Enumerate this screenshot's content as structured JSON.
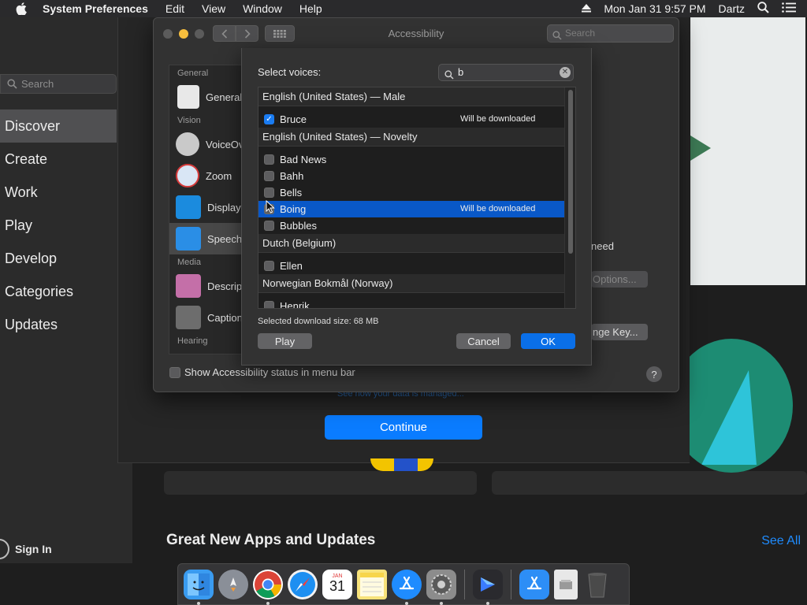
{
  "menubar": {
    "app_name": "System Preferences",
    "menus": [
      "Edit",
      "View",
      "Window",
      "Help"
    ],
    "datetime": "Mon Jan 31  9:57 PM",
    "user": "Dartz"
  },
  "store": {
    "search_placeholder": "Search",
    "nav": [
      {
        "label": "Discover",
        "active": true
      },
      {
        "label": "Create"
      },
      {
        "label": "Work"
      },
      {
        "label": "Play"
      },
      {
        "label": "Develop"
      },
      {
        "label": "Categories"
      },
      {
        "label": "Updates"
      }
    ],
    "sign_in": "Sign In",
    "section_title": "Great New Apps and Updates",
    "see_all": "See All",
    "link_text": "See how your data is managed...",
    "continue": "Continue"
  },
  "accessibility": {
    "title": "Accessibility",
    "search_placeholder": "Search",
    "sections": [
      {
        "header": "General",
        "items": [
          {
            "label": "General",
            "icon": "switch-icon"
          }
        ]
      },
      {
        "header": "Vision",
        "items": [
          {
            "label": "VoiceOver",
            "icon": "voiceover-icon"
          },
          {
            "label": "Zoom",
            "icon": "zoom-icon"
          },
          {
            "label": "Display",
            "icon": "display-icon"
          },
          {
            "label": "Speech",
            "icon": "speech-icon",
            "selected": true
          }
        ]
      },
      {
        "header": "Media",
        "items": [
          {
            "label": "Descriptions",
            "icon": "descriptions-icon"
          },
          {
            "label": "Captions",
            "icon": "captions-icon"
          }
        ]
      },
      {
        "header": "Hearing",
        "items": []
      }
    ],
    "status_checkbox": "Show Accessibility status in menu bar",
    "help": "?",
    "right_text_need": "need",
    "options_button": "Options...",
    "change_key_button": "nge Key..."
  },
  "voices": {
    "label": "Select voices:",
    "search_value": "b",
    "groups": [
      {
        "name": "English (United States) — Male",
        "items": [
          {
            "name": "Bruce",
            "checked": true,
            "note": "Will be downloaded"
          }
        ]
      },
      {
        "name": "English (United States) — Novelty",
        "items": [
          {
            "name": "Bad News",
            "checked": false
          },
          {
            "name": "Bahh",
            "checked": false
          },
          {
            "name": "Bells",
            "checked": false
          },
          {
            "name": "Boing",
            "checked": false,
            "selected": true,
            "note": "Will be downloaded"
          },
          {
            "name": "Bubbles",
            "checked": false
          }
        ]
      },
      {
        "name": "Dutch (Belgium)",
        "items": [
          {
            "name": "Ellen",
            "checked": false
          }
        ]
      },
      {
        "name": "Norwegian Bokmål (Norway)",
        "items": [
          {
            "name": "Henrik",
            "checked": false
          }
        ]
      }
    ],
    "download_size": "Selected download size: 68 MB",
    "play": "Play",
    "cancel": "Cancel",
    "ok": "OK"
  },
  "dock": {
    "apps": [
      {
        "name": "Finder",
        "icon": "finder-icon",
        "color": "#3a9bf0",
        "running": true
      },
      {
        "name": "Launchpad",
        "icon": "launchpad-icon",
        "color": "#8a8f98",
        "running": false
      },
      {
        "name": "Chrome",
        "icon": "chrome-icon",
        "color": "#ffffff",
        "running": true
      },
      {
        "name": "Safari",
        "icon": "safari-icon",
        "color": "#1d8ff1",
        "running": false
      },
      {
        "name": "Calendar",
        "icon": "calendar-icon",
        "color": "#ffffff",
        "running": false,
        "text": "31",
        "subtext": "JAN"
      },
      {
        "name": "Notes",
        "icon": "notes-icon",
        "color": "#f7e27a",
        "running": false
      },
      {
        "name": "App Store",
        "icon": "app-store-icon",
        "color": "#1f8cff",
        "running": true
      },
      {
        "name": "System Preferences",
        "icon": "system-preferences-icon",
        "color": "#8c8c8c",
        "running": true
      }
    ],
    "extra": [
      {
        "name": "Video App",
        "icon": "video-app-icon",
        "color": "#2a2a2e",
        "running": true
      }
    ],
    "right": [
      {
        "name": "App Store Downloads",
        "icon": "app-store-folder-icon",
        "color": "#2d8ef6"
      },
      {
        "name": "Document",
        "icon": "document-icon",
        "color": "#e8e8e8"
      },
      {
        "name": "Trash",
        "icon": "trash-icon",
        "color": "#5c5c5c"
      }
    ]
  }
}
